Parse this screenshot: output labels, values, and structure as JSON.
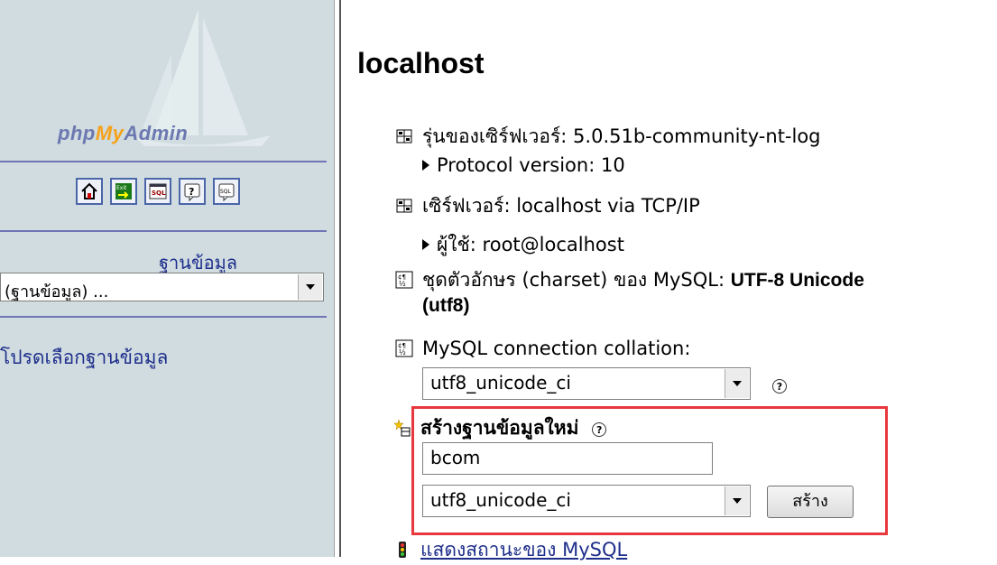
{
  "sidebar": {
    "logo": {
      "php": "php",
      "my": "My",
      "admin": "Admin"
    },
    "toolbar_icons": [
      "home-icon",
      "exit-icon",
      "sql-query-icon",
      "help-icon",
      "sql-docs-icon"
    ],
    "databases_label": "ฐานข้อมูล",
    "database_select_value": "(ฐานข้อมูล) ...",
    "hint": "โปรดเลือกฐานข้อมูล"
  },
  "main": {
    "title": "localhost",
    "server_version": "รุ่นของเซิร์ฟเวอร์: 5.0.51b-community-nt-log",
    "protocol_version": "Protocol version: 10",
    "server": "เซิร์ฟเวอร์: localhost via TCP/IP",
    "user": "ผู้ใช้: root@localhost",
    "charset_prefix": "ชุดตัวอักษร (charset) ของ MySQL: ",
    "charset_value_line1": "UTF-8 Unicode",
    "charset_value_line2": "(utf8)",
    "collation_label": "MySQL connection collation:",
    "collation_value": "utf8_unicode_ci",
    "create_db_label": "สร้างฐานข้อมูลใหม่",
    "create_db_name_value": "bcom",
    "create_db_collation_value": "utf8_unicode_ci",
    "create_button": "สร้าง",
    "status_link": "แสดงสถานะของ MySQL",
    "help_glyph": "?"
  },
  "colors": {
    "sidebar_bg": "#d0dce0",
    "link": "#1e2e8b",
    "highlight_border": "#e8383d"
  }
}
